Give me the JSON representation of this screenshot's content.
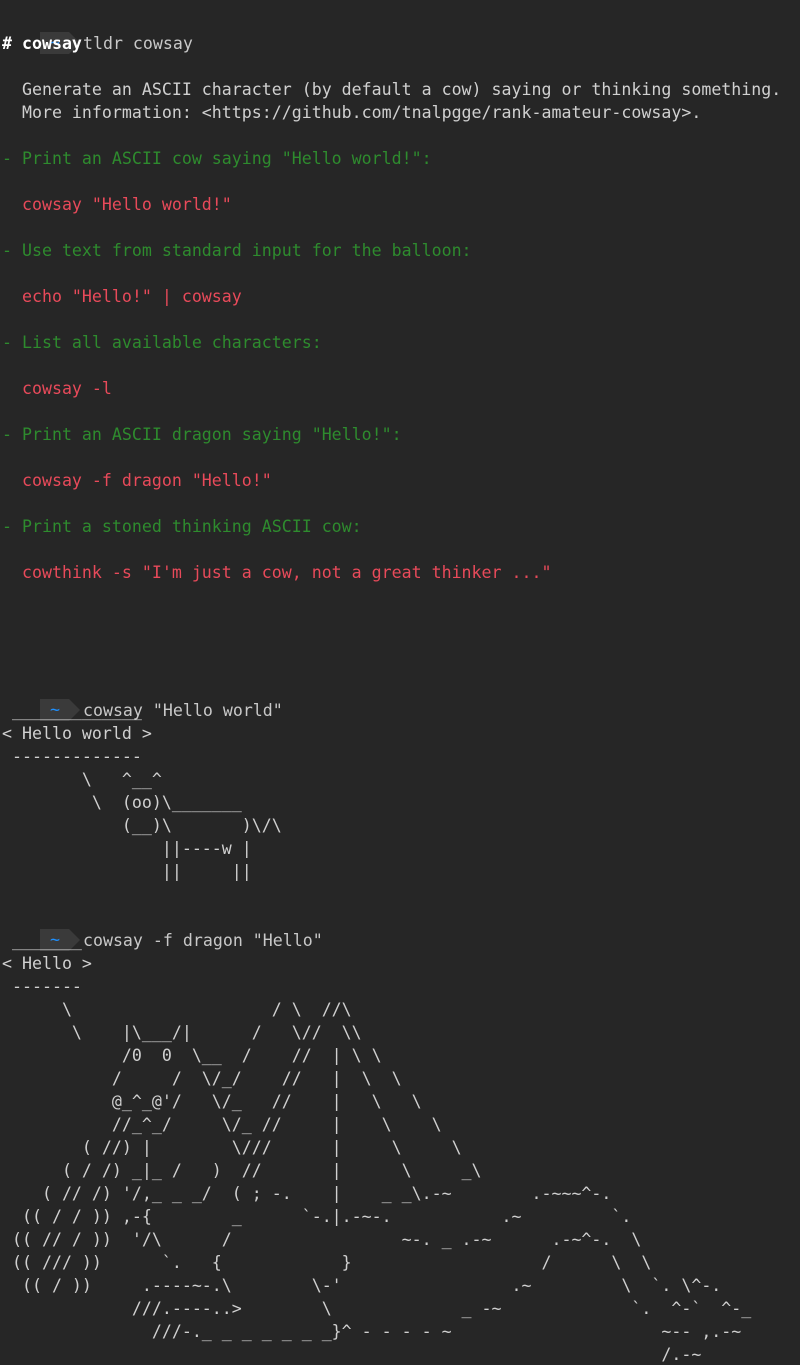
{
  "prompt": {
    "symbol": "~"
  },
  "session1": {
    "command": "tldr cowsay",
    "heading": "# cowsay",
    "description": [
      "Generate an ASCII character (by default a cow) saying or thinking something.",
      "More information: <https://github.com/tnalpgge/rank-amateur-cowsay>."
    ],
    "examples": [
      {
        "comment": "- Print an ASCII cow saying \"Hello world!\":",
        "code": "cowsay \"Hello world!\""
      },
      {
        "comment": "- Use text from standard input for the balloon:",
        "code": "echo \"Hello!\" | cowsay"
      },
      {
        "comment": "- List all available characters:",
        "code": "cowsay -l"
      },
      {
        "comment": "- Print an ASCII dragon saying \"Hello!\":",
        "code": "cowsay -f dragon \"Hello!\""
      },
      {
        "comment": "- Print a stoned thinking ASCII cow:",
        "code": "cowthink -s \"I'm just a cow, not a great thinker ...\""
      }
    ]
  },
  "session2": {
    "command": "cowsay \"Hello world\"",
    "output": [
      " _____________",
      "< Hello world >",
      " -------------",
      "        \\   ^__^",
      "         \\  (oo)\\_______",
      "            (__)\\       )\\/\\",
      "                ||----w |",
      "                ||     ||"
    ]
  },
  "session3": {
    "command": "cowsay -f dragon \"Hello\"",
    "output": [
      " _______",
      "< Hello >",
      " -------",
      "      \\                    / \\  //\\",
      "       \\    |\\___/|      /   \\//  \\\\",
      "            /0  0  \\__  /    //  | \\ \\",
      "           /     /  \\/_/    //   |  \\  \\",
      "           @_^_@'/   \\/_   //    |   \\   \\",
      "           //_^_/     \\/_ //     |    \\    \\",
      "        ( //) |        \\///      |     \\     \\",
      "      ( / /) _|_ /   )  //       |      \\     _\\",
      "    ( // /) '/,_ _ _/  ( ; -.    |    _ _\\.-~        .-~~~^-.",
      "  (( / / )) ,-{        _      `-.|.-~-.           .~         `.",
      " (( // / ))  '/\\      /                 ~-. _ .-~      .-~^-.  \\",
      " (( /// ))      `.   {            }                   /      \\  \\",
      "  (( / ))     .----~-.\\        \\-'                 .~         \\  `. \\^-.",
      "             ///.----..>        \\             _ -~             `.  ^-`  ^-_",
      "               ///-._ _ _ _ _ _ _}^ - - - - ~                     ~-- ,.-~",
      "                                                                  /.-~"
    ]
  }
}
